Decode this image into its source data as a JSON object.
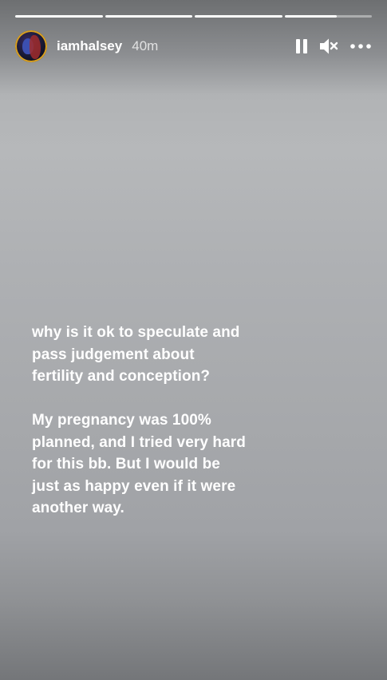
{
  "story": {
    "progress": [
      1,
      1,
      1,
      0.6
    ],
    "username": "iamhalsey",
    "time_ago": "40m",
    "icons": {
      "pause": "pause-icon",
      "mute": "muted-speaker-icon",
      "more": "more-options-icon"
    },
    "text": {
      "paragraph_1": "why is it ok to speculate and pass judgement about fertility and conception?",
      "paragraph_2": "My pregnancy was 100% planned, and I tried very hard for this bb. But I would be just as happy even if it were another way."
    }
  }
}
